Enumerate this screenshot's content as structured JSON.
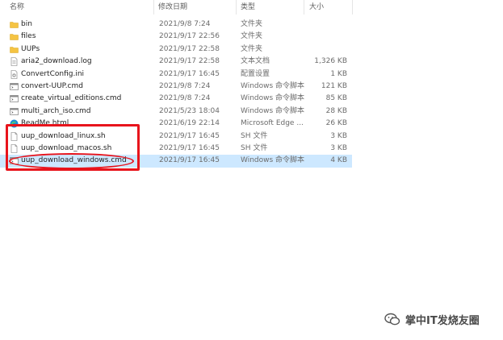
{
  "columns": {
    "name": "名称",
    "date": "修改日期",
    "type": "类型",
    "size": "大小"
  },
  "files": [
    {
      "name": "bin",
      "date": "2021/9/8 7:24",
      "type": "文件夹",
      "size": "",
      "icon": "folder-icon"
    },
    {
      "name": "files",
      "date": "2021/9/17 22:56",
      "type": "文件夹",
      "size": "",
      "icon": "folder-icon"
    },
    {
      "name": "UUPs",
      "date": "2021/9/17 22:58",
      "type": "文件夹",
      "size": "",
      "icon": "folder-icon"
    },
    {
      "name": "aria2_download.log",
      "date": "2021/9/17 22:58",
      "type": "文本文档",
      "size": "1,326 KB",
      "icon": "text-file-icon"
    },
    {
      "name": "ConvertConfig.ini",
      "date": "2021/9/17 16:45",
      "type": "配置设置",
      "size": "1 KB",
      "icon": "config-file-icon"
    },
    {
      "name": "convert-UUP.cmd",
      "date": "2021/9/8 7:24",
      "type": "Windows 命令脚本",
      "size": "121 KB",
      "icon": "cmd-file-icon"
    },
    {
      "name": "create_virtual_editions.cmd",
      "date": "2021/9/8 7:24",
      "type": "Windows 命令脚本",
      "size": "85 KB",
      "icon": "cmd-file-icon"
    },
    {
      "name": "multi_arch_iso.cmd",
      "date": "2021/5/23 18:04",
      "type": "Windows 命令脚本",
      "size": "28 KB",
      "icon": "cmd-file-icon"
    },
    {
      "name": "ReadMe.html",
      "date": "2021/6/19 22:14",
      "type": "Microsoft Edge ...",
      "size": "26 KB",
      "icon": "edge-icon"
    },
    {
      "name": "uup_download_linux.sh",
      "date": "2021/9/17 16:45",
      "type": "SH 文件",
      "size": "3 KB",
      "icon": "blank-file-icon"
    },
    {
      "name": "uup_download_macos.sh",
      "date": "2021/9/17 16:45",
      "type": "SH 文件",
      "size": "3 KB",
      "icon": "blank-file-icon"
    },
    {
      "name": "uup_download_windows.cmd",
      "date": "2021/9/17 16:45",
      "type": "Windows 命令脚本",
      "size": "4 KB",
      "icon": "cmd-file-icon",
      "selected": true
    }
  ],
  "watermark": {
    "text": "掌中IT发烧友圈"
  },
  "colors": {
    "annotation": "#e8141c",
    "folder": "#f5c443",
    "selection": "#cde8ff"
  }
}
